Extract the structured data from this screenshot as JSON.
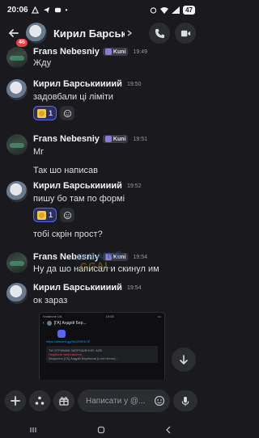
{
  "status_bar": {
    "time": "20:06",
    "battery": "47"
  },
  "header": {
    "title": "Кирил Барськ...",
    "badge": "46"
  },
  "messages": [
    {
      "author": "Frans Nebesniy",
      "tag": "Kuni",
      "time": "19:49",
      "text": "Жду"
    },
    {
      "author": "Кирил Барськиииий",
      "time": "19:50",
      "text": "задовбали ці ліміти",
      "reaction_count": "1"
    },
    {
      "author": "Frans Nebesniy",
      "tag": "Kuni",
      "time": "19:51",
      "text": "Мг",
      "text2": "Так шо написав"
    },
    {
      "author": "Кирил Барськиииий",
      "time": "19:52",
      "text": "пишу бо там по формі",
      "reaction_count": "1",
      "text2": "тобі скрін прост?"
    },
    {
      "author": "Frans Nebesniy",
      "tag": "Kuni",
      "time": "19:54",
      "text": "Ну да шо написал и скинул им"
    },
    {
      "author": "Кирил Барськиииий",
      "time": "19:54",
      "text": "ок зараз"
    }
  ],
  "watermark": {
    "line1": "UKRAINE",
    "line2": "GGAL"
  },
  "attachment": {
    "status_left": "Vodafone UA",
    "status_time": "19:55",
    "title": "[ГА] Андрій Бер...",
    "link": "https://discord.gg/9hJ20KGr7Z",
    "card_line1": "ТИ ОТРИМАВ ЗАПРОШЕННЯ, АЛЕ...",
    "card_line2": "Недійсне запрошення",
    "card_line3": "Запросіть [ГА] Андрій Бергієнов (Lord Henor)..."
  },
  "composer": {
    "placeholder": "Написати у @..."
  },
  "colors": {
    "background": "#1a1a1e",
    "accent": "#5865f2",
    "danger": "#f23f42"
  }
}
